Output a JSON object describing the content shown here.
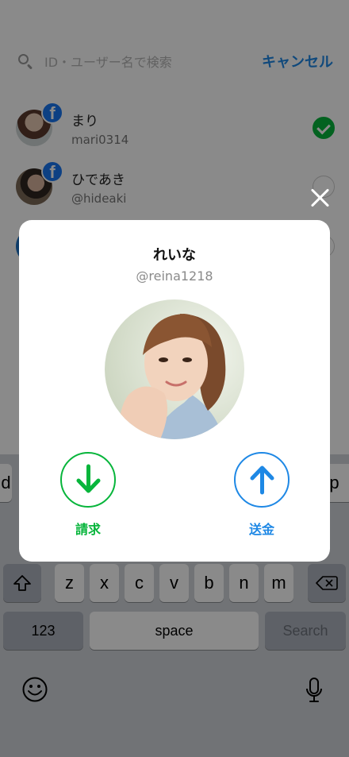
{
  "search": {
    "placeholder": "ID・ユーザー名で検索",
    "cancel_label": "キャンセル"
  },
  "friends": [
    {
      "name": "まり",
      "id": "mari0314",
      "selected": true
    },
    {
      "name": "ひであき",
      "id": "@hideaki",
      "selected": false
    },
    {
      "name": "",
      "id": "",
      "selected": false
    }
  ],
  "modal": {
    "name": "れいな",
    "id": "@reina1218",
    "request_label": "請求",
    "send_label": "送金"
  },
  "keyboard": {
    "row2_partial_left": "d",
    "row2_partial_right": "p",
    "row3": [
      "z",
      "x",
      "c",
      "v",
      "b",
      "n",
      "m"
    ],
    "numbers_label": "123",
    "space_label": "space",
    "search_label": "Search"
  },
  "colors": {
    "line_green": "#07B53B",
    "blue": "#1E88E5",
    "facebook_blue": "#1877F2"
  },
  "icons": [
    "search-icon",
    "facebook-icon",
    "check-icon",
    "close-icon",
    "arrow-down-icon",
    "arrow-up-icon",
    "shift-icon",
    "backspace-icon",
    "emoji-icon",
    "microphone-icon"
  ]
}
